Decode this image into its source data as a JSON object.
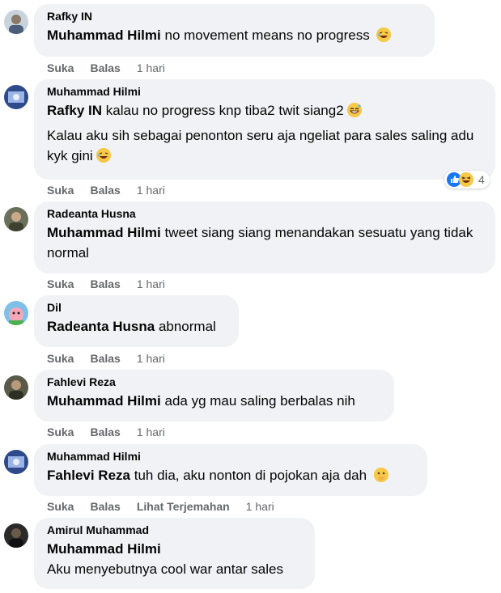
{
  "comments": [
    {
      "author": "Rafky IN",
      "mention": "Muhammad Hilmi",
      "text": "no movement means no progress",
      "emoji": "rolling-laughing-emoji",
      "actions": {
        "like": "Suka",
        "reply": "Balas",
        "time": "1 hari"
      }
    },
    {
      "author": "Muhammad Hilmi",
      "mention": "Rafky IN",
      "text": "kalau no progress knp tiba2 twit siang2",
      "emoji": "grinning-sweat-emoji",
      "text2": "Kalau aku sih sebagai penonton seru aja ngeliat para sales saling adu kyk gini",
      "emoji2": "rolling-laughing-emoji",
      "reactions": {
        "count": "4",
        "icons": [
          "like-reaction-icon",
          "haha-reaction-icon"
        ]
      },
      "actions": {
        "like": "Suka",
        "reply": "Balas",
        "time": "1 hari"
      }
    },
    {
      "author": "Radeanta Husna",
      "mention": "Muhammad Hilmi",
      "text": "tweet siang siang menandakan sesuatu yang tidak normal",
      "actions": {
        "like": "Suka",
        "reply": "Balas",
        "time": "1 hari"
      }
    },
    {
      "author": "Dil",
      "mention": "Radeanta Husna",
      "text": "abnormal",
      "actions": {
        "like": "Suka",
        "reply": "Balas",
        "time": "1 hari"
      }
    },
    {
      "author": "Fahlevi Reza",
      "mention": "Muhammad Hilmi",
      "text": "ada yg mau saling berbalas nih",
      "actions": {
        "like": "Suka",
        "reply": "Balas",
        "time": "1 hari"
      }
    },
    {
      "author": "Muhammad Hilmi",
      "mention": "Fahlevi Reza",
      "text": "tuh dia, aku nonton di pojokan aja dah",
      "emoji": "hand-over-mouth-emoji",
      "actions": {
        "like": "Suka",
        "reply": "Balas",
        "translate": "Lihat Terjemahan",
        "time": "1 hari"
      }
    },
    {
      "author": "Amirul Muhammad",
      "mention": "Muhammad Hilmi",
      "text2": "Aku menyebutnya cool war antar sales"
    }
  ],
  "colors": {
    "bubble": "#f0f2f5",
    "secondary_text": "#65676b",
    "like_blue": "#1877f2",
    "emoji_yellow": "#f7c948"
  }
}
